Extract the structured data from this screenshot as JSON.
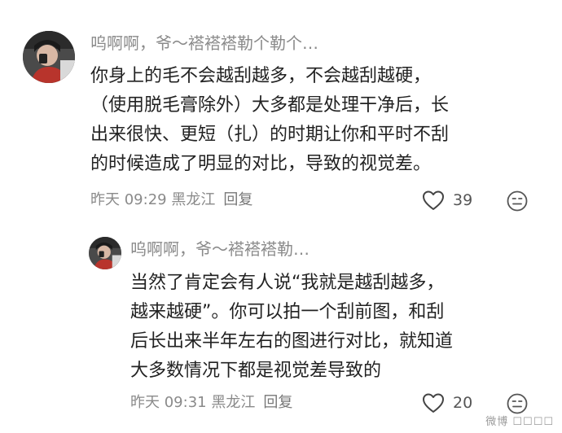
{
  "comments": [
    {
      "username": "呜啊啊，爷～褡褡褡勒个勒个…",
      "text_lines": [
        "你身上的毛不会越刮越多，不会越刮越硬，",
        "（使用脱毛膏除外）大多都是处理干净后，长",
        "出来很快、更短（扎）的时期让你和平时不刮",
        "的时候造成了明显的对比，导致的视觉差。"
      ],
      "meta": "昨天 09:29 黑龙江",
      "reply_label": "回复",
      "likes": "39",
      "avatar_icon": "user-avatar"
    },
    {
      "username": "呜啊啊，爷～褡褡褡勒…",
      "text_lines": [
        "当然了肯定会有人说“我就是越刮越多，",
        "越来越硬”。你可以拍一个刮前图，和刮",
        "后长出来半年左右的图进行对比，就知道",
        "大多数情况下都是视觉差导致的"
      ],
      "meta": "昨天 09:31 黑龙江",
      "reply_label": "回复",
      "likes": "20",
      "avatar_icon": "user-avatar"
    }
  ],
  "watermark": "微博 ☐☐☐☐",
  "colors": {
    "text": "#222222",
    "muted": "#8a8a8a",
    "background": "#ffffff"
  },
  "icons": [
    "heart-icon",
    "emoji-icon"
  ]
}
